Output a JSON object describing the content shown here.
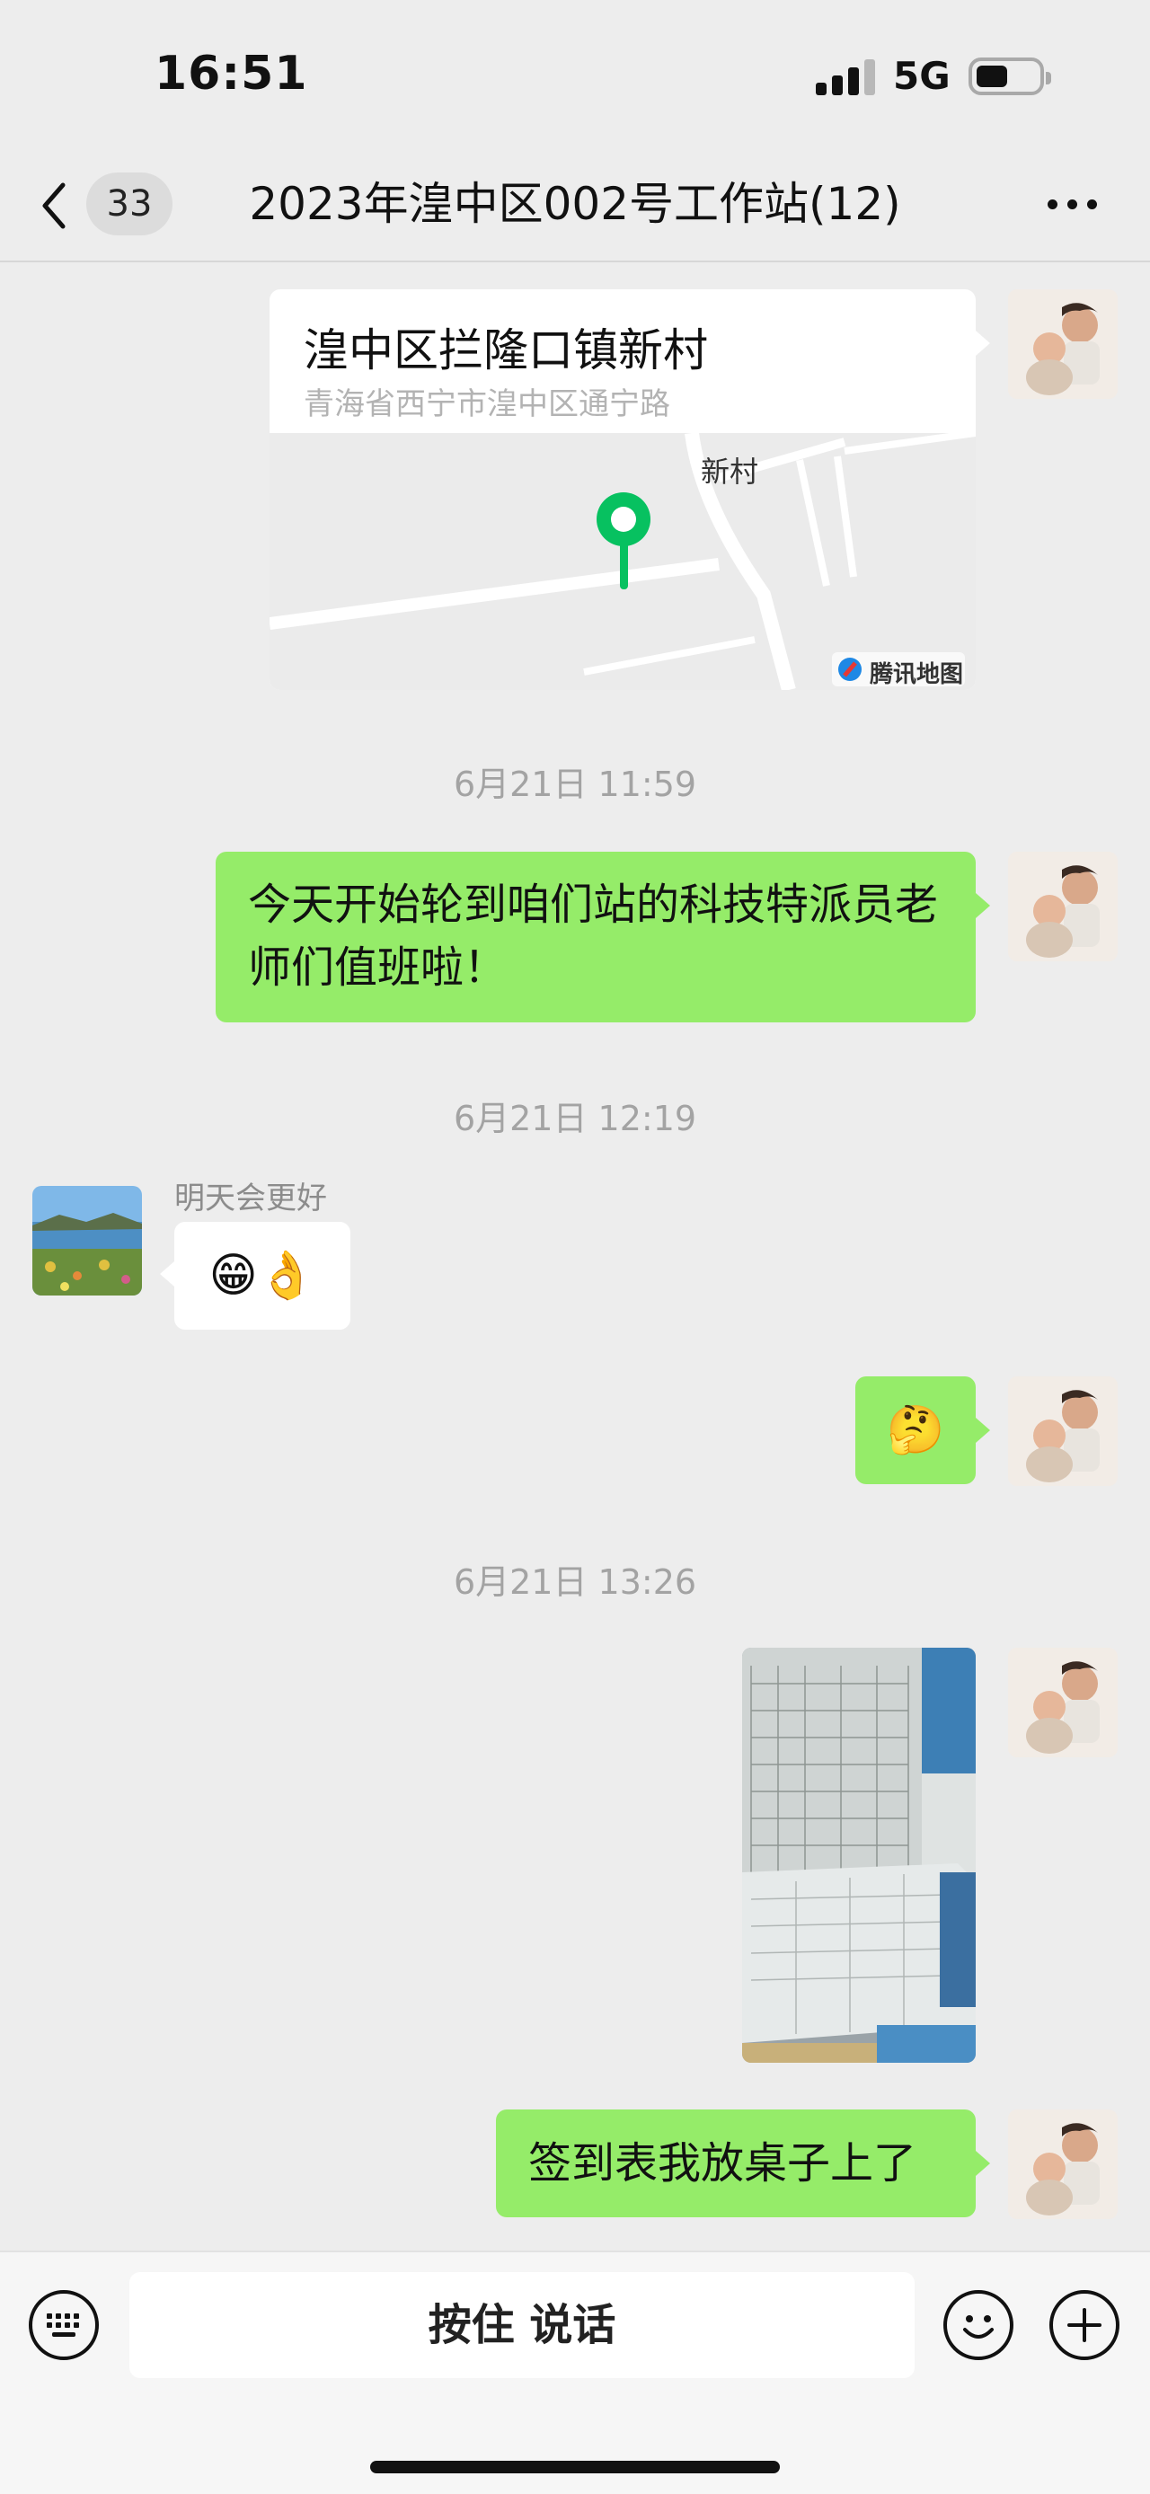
{
  "status_bar": {
    "time": "16:51",
    "network": "5G",
    "battery_level": 0.45
  },
  "header": {
    "back_icon": "chevron-left-icon",
    "unread_count": "33",
    "title": "2023年湟中区002号工作站(12)",
    "more_icon": "more-dots-icon"
  },
  "messages": {
    "location": {
      "title": "湟中区拦隆口镇新村",
      "address": "青海省西宁市湟中区通宁路",
      "map_label": "新村",
      "map_provider": "腾讯地图",
      "pin_color": "#07c160"
    },
    "ts1": "6月21日 11:59",
    "msg1": "今天开始轮到咱们站的科技特派员老师们值班啦！",
    "ts2": "6月21日 12:19",
    "sender_name": "明天会更好",
    "reply_emoji": "😁👌",
    "self_emoji": "🤔",
    "ts3": "6月21日 13:26",
    "photo_icon": "photo-sign-in-sheet",
    "msg2": "签到表我放桌子上了"
  },
  "input_bar": {
    "keyboard_icon": "keyboard-icon",
    "hold_to_talk": "按住 说话",
    "emoji_icon": "smiley-icon",
    "add_icon": "plus-icon"
  },
  "colors": {
    "bubble_green": "#95ec69",
    "background": "#ededed",
    "pin": "#07c160"
  }
}
